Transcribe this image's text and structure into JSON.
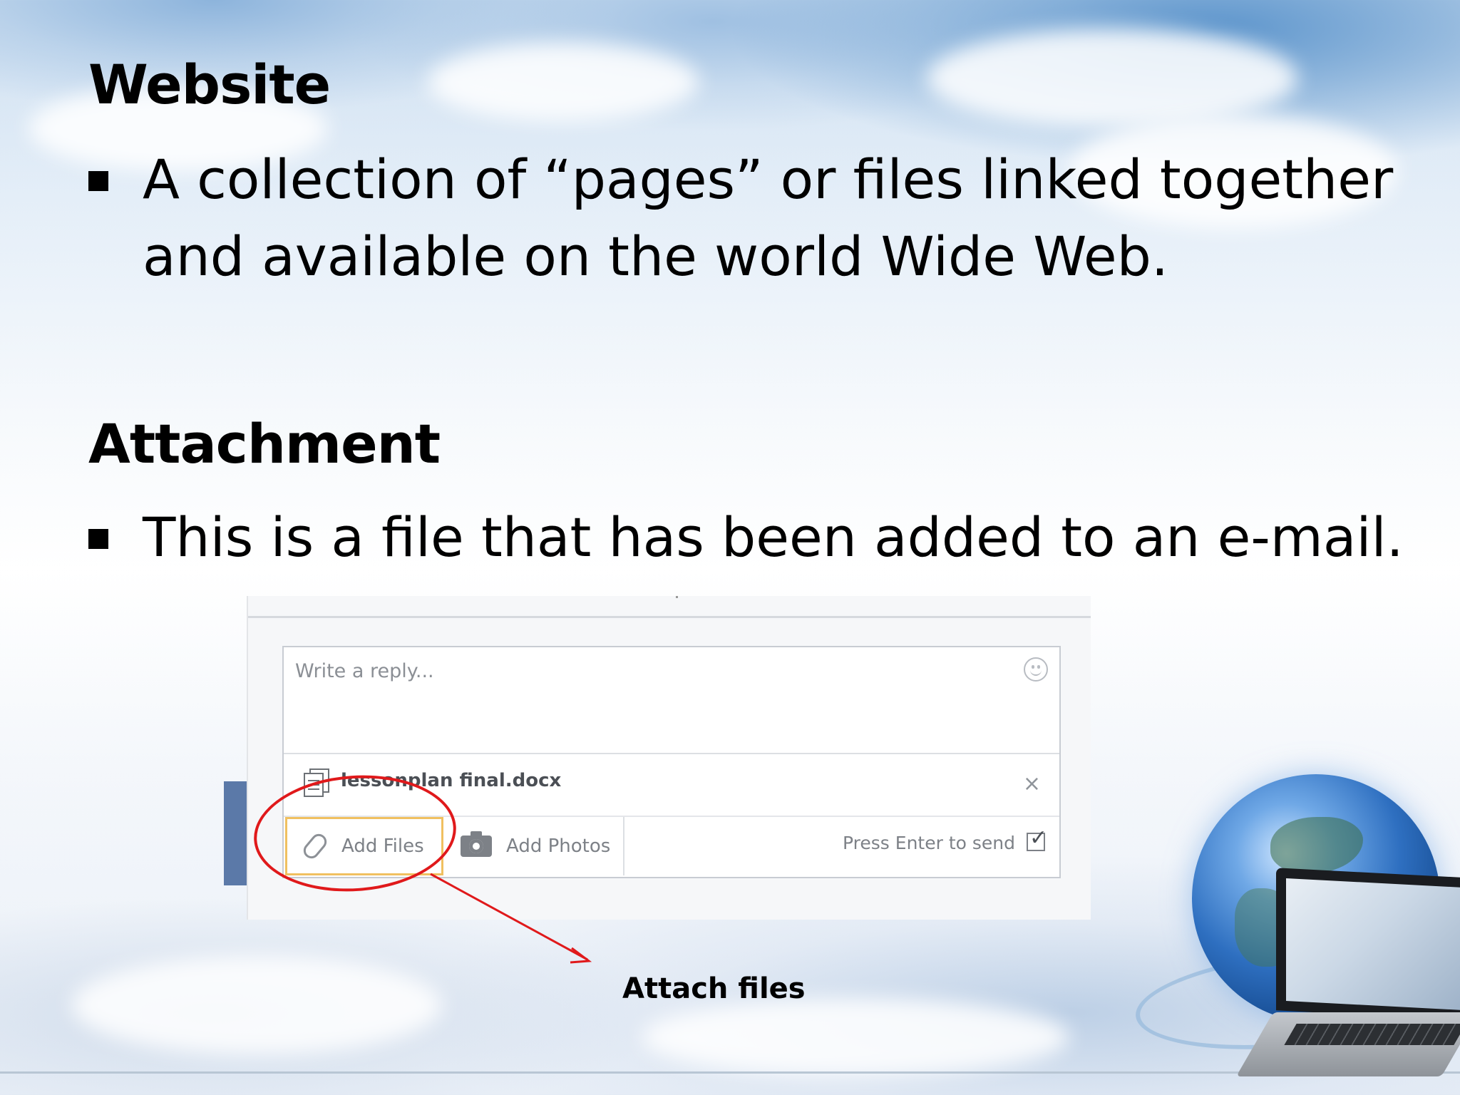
{
  "slide": {
    "heading1": "Website",
    "bullet1": "A collection of “pages” or files linked together and available on the world Wide Web.",
    "heading2": "Attachment",
    "bullet2": "This is a file that has been added to an e-mail."
  },
  "screenshot": {
    "reply_placeholder": "Write a reply...",
    "attachment_name": "lessonplan final.docx",
    "remove_symbol": "×",
    "add_files_label": "Add Files",
    "add_photos_label": "Add Photos",
    "press_enter_label": "Press Enter to send",
    "press_enter_checked": true
  },
  "annotation": {
    "caption": "Attach files",
    "color": "#e0191b"
  },
  "icons": [
    "smiley-icon",
    "document-icon",
    "close-icon",
    "paperclip-icon",
    "camera-icon",
    "checkbox-icon",
    "bullet-square-icon"
  ]
}
